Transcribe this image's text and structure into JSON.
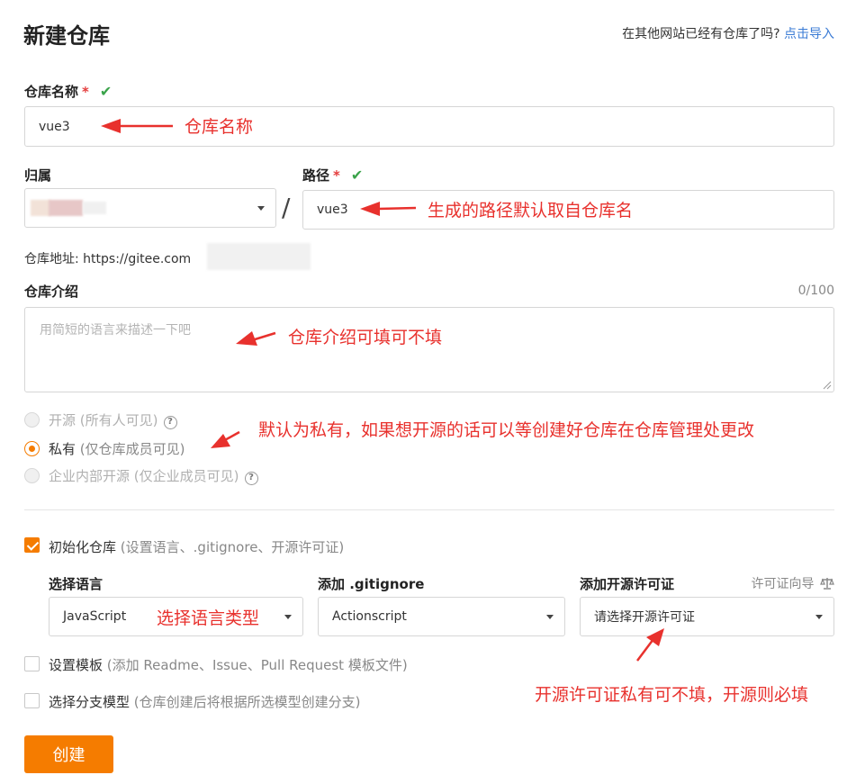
{
  "header": {
    "title": "新建仓库",
    "import_question": "在其他网站已经有仓库了吗?",
    "import_link": "点击导入"
  },
  "repo_name": {
    "label": "仓库名称",
    "required_mark": "*",
    "value": "vue3",
    "annotation": "仓库名称"
  },
  "owner": {
    "label": "归属"
  },
  "separator": "/",
  "path": {
    "label": "路径",
    "required_mark": "*",
    "value": "vue3",
    "annotation": "生成的路径默认取自仓库名"
  },
  "address": {
    "label": "仓库地址:",
    "url": "https://gitee.com"
  },
  "intro": {
    "label": "仓库介绍",
    "counter": "0/100",
    "placeholder": "用简短的语言来描述一下吧",
    "annotation": "仓库介绍可填可不填"
  },
  "visibility": {
    "options": [
      {
        "label": "开源",
        "hint": "(所有人可见)",
        "selected": false,
        "disabled": true
      },
      {
        "label": "私有",
        "hint": "(仅仓库成员可见)",
        "selected": true,
        "disabled": false
      },
      {
        "label": "企业内部开源",
        "hint": "(仅企业成员可见)",
        "selected": false,
        "disabled": true
      }
    ],
    "help_icon": "?",
    "annotation": "默认为私有，如果想开源的话可以等创建好仓库在仓库管理处更改"
  },
  "init": {
    "label": "初始化仓库",
    "hint": "(设置语言、.gitignore、开源许可证)",
    "checked": true
  },
  "language": {
    "label": "选择语言",
    "value": "JavaScript",
    "annotation": "选择语言类型"
  },
  "gitignore": {
    "label": "添加 .gitignore",
    "value": "Actionscript"
  },
  "license": {
    "label": "添加开源许可证",
    "guide": "许可证向导",
    "guide_icon": "scale-icon",
    "value": "请选择开源许可证",
    "annotation": "开源许可证私有可不填，开源则必填"
  },
  "template": {
    "label": "设置模板",
    "hint": "(添加 Readme、Issue、Pull Request 模板文件)",
    "checked": false
  },
  "branch": {
    "label": "选择分支模型",
    "hint": "(仓库创建后将根据所选模型创建分支)",
    "checked": false
  },
  "submit": {
    "label": "创建"
  },
  "colors": {
    "accent": "#f57c00",
    "link": "#3a7bd5",
    "annotation": "#e8312d",
    "check": "#3aa34a"
  }
}
